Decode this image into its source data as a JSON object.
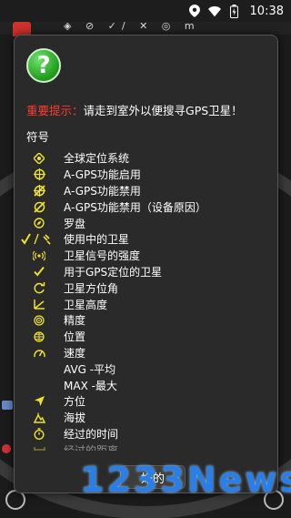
{
  "status_bar": {
    "time": "10:38",
    "icons": [
      "location-icon",
      "wifi-icon",
      "battery-icon"
    ]
  },
  "background_toolbar": {
    "glyphs": "◈ ⊘  ✓/  ✕  ◎ m"
  },
  "dialog": {
    "help_icon": "?",
    "notice_label": "重要提示：",
    "notice_text": "请走到室外以便搜寻GPS卫星！",
    "legend_title": "符号",
    "legend": [
      {
        "icon": "gps-diamond-icon",
        "label": "全球定位系统"
      },
      {
        "icon": "agps-enabled-icon",
        "label": "A-GPS功能启用"
      },
      {
        "icon": "agps-disabled-icon",
        "label": "A-GPS功能禁用"
      },
      {
        "icon": "agps-disabled-device-icon",
        "label": "A-GPS功能禁用（设备原因）"
      },
      {
        "icon": "compass-icon",
        "label": "罗盘"
      },
      {
        "icon": "satellite-in-use-icon",
        "label": "使用中的卫星"
      },
      {
        "icon": "signal-strength-icon",
        "label": "卫星信号的强度"
      },
      {
        "icon": "gps-fix-satellite-icon",
        "label": "用于GPS定位的卫星"
      },
      {
        "icon": "azimuth-icon",
        "label": "卫星方位角"
      },
      {
        "icon": "elevation-icon",
        "label": "卫星高度"
      },
      {
        "icon": "accuracy-icon",
        "label": "精度"
      },
      {
        "icon": "position-icon",
        "label": "位置"
      },
      {
        "icon": "speed-icon",
        "label": "速度"
      },
      {
        "icon": "",
        "label": "AVG -平均"
      },
      {
        "icon": "",
        "label": "MAX -最大"
      },
      {
        "icon": "bearing-icon",
        "label": "方位"
      },
      {
        "icon": "altitude-icon",
        "label": "海拔"
      },
      {
        "icon": "elapsed-time-icon",
        "label": "经过的时间"
      },
      {
        "icon": "distance-icon",
        "label": "经过的距离"
      }
    ],
    "ok_label": "好的"
  },
  "watermark": "1233News",
  "colors": {
    "accent_yellow": "#f0e22a",
    "notice_red": "#ff3b2f",
    "help_green": "#1e9a1a",
    "watermark_blue": "#2a7fe6"
  }
}
